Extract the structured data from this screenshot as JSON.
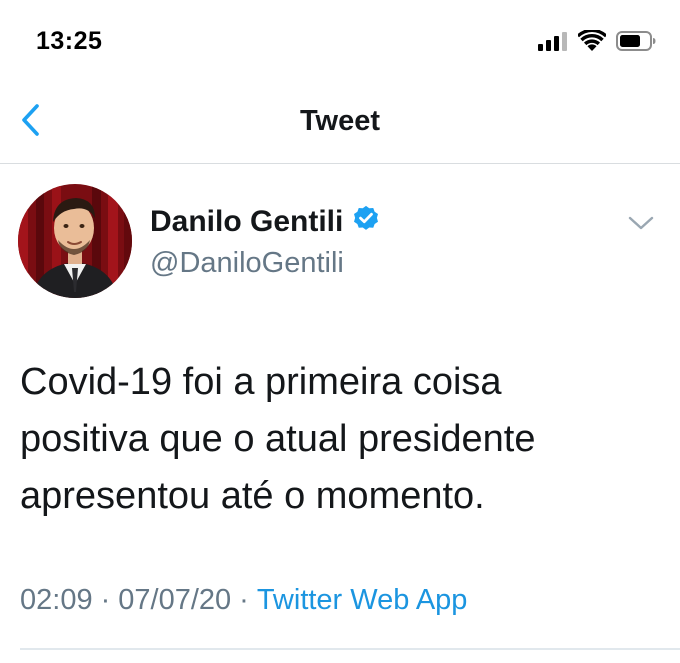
{
  "status_bar": {
    "time": "13:25",
    "icons": [
      "cellular-signal-icon",
      "wifi-icon",
      "battery-icon"
    ]
  },
  "nav": {
    "back_icon": "chevron-left-icon",
    "title": "Tweet"
  },
  "tweet": {
    "author": {
      "name": "Danilo Gentili",
      "handle": "@DaniloGentili",
      "verified": true,
      "avatar": "author-avatar"
    },
    "menu_icon": "chevron-down-icon",
    "text_lines": [
      "Covid-19 foi a primeira coisa",
      "positiva que o atual presidente",
      "apresentou até o momento."
    ],
    "time": "02:09",
    "date": "07/07/20",
    "source": "Twitter Web App",
    "separator": "·"
  },
  "colors": {
    "accent": "#1b95e0",
    "verified": "#1da1f2",
    "secondary_text": "#657786",
    "primary_text": "#14171a",
    "divider": "#e1e8ed"
  }
}
